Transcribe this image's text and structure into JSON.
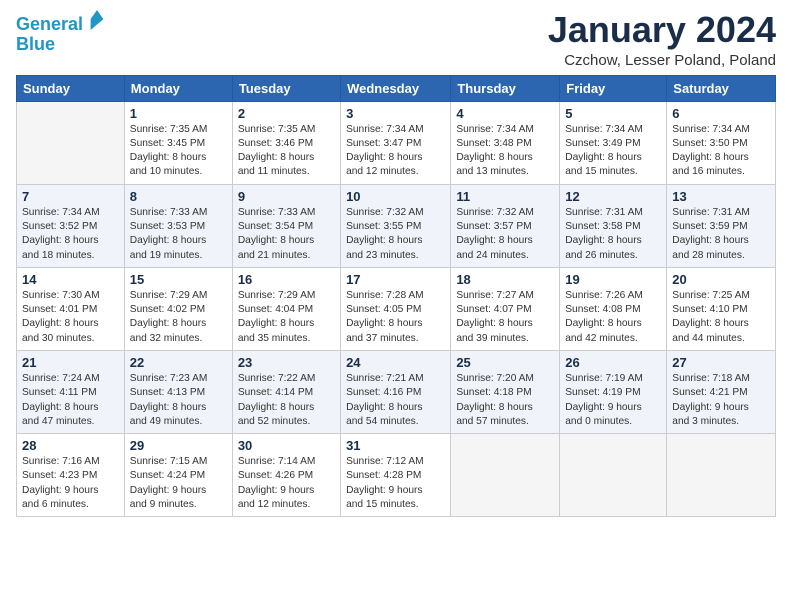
{
  "logo": {
    "line1": "General",
    "line2": "Blue"
  },
  "title": "January 2024",
  "location": "Czchow, Lesser Poland, Poland",
  "weekdays": [
    "Sunday",
    "Monday",
    "Tuesday",
    "Wednesday",
    "Thursday",
    "Friday",
    "Saturday"
  ],
  "weeks": [
    [
      {
        "day": "",
        "info": ""
      },
      {
        "day": "1",
        "info": "Sunrise: 7:35 AM\nSunset: 3:45 PM\nDaylight: 8 hours\nand 10 minutes."
      },
      {
        "day": "2",
        "info": "Sunrise: 7:35 AM\nSunset: 3:46 PM\nDaylight: 8 hours\nand 11 minutes."
      },
      {
        "day": "3",
        "info": "Sunrise: 7:34 AM\nSunset: 3:47 PM\nDaylight: 8 hours\nand 12 minutes."
      },
      {
        "day": "4",
        "info": "Sunrise: 7:34 AM\nSunset: 3:48 PM\nDaylight: 8 hours\nand 13 minutes."
      },
      {
        "day": "5",
        "info": "Sunrise: 7:34 AM\nSunset: 3:49 PM\nDaylight: 8 hours\nand 15 minutes."
      },
      {
        "day": "6",
        "info": "Sunrise: 7:34 AM\nSunset: 3:50 PM\nDaylight: 8 hours\nand 16 minutes."
      }
    ],
    [
      {
        "day": "7",
        "info": "Sunrise: 7:34 AM\nSunset: 3:52 PM\nDaylight: 8 hours\nand 18 minutes."
      },
      {
        "day": "8",
        "info": "Sunrise: 7:33 AM\nSunset: 3:53 PM\nDaylight: 8 hours\nand 19 minutes."
      },
      {
        "day": "9",
        "info": "Sunrise: 7:33 AM\nSunset: 3:54 PM\nDaylight: 8 hours\nand 21 minutes."
      },
      {
        "day": "10",
        "info": "Sunrise: 7:32 AM\nSunset: 3:55 PM\nDaylight: 8 hours\nand 23 minutes."
      },
      {
        "day": "11",
        "info": "Sunrise: 7:32 AM\nSunset: 3:57 PM\nDaylight: 8 hours\nand 24 minutes."
      },
      {
        "day": "12",
        "info": "Sunrise: 7:31 AM\nSunset: 3:58 PM\nDaylight: 8 hours\nand 26 minutes."
      },
      {
        "day": "13",
        "info": "Sunrise: 7:31 AM\nSunset: 3:59 PM\nDaylight: 8 hours\nand 28 minutes."
      }
    ],
    [
      {
        "day": "14",
        "info": "Sunrise: 7:30 AM\nSunset: 4:01 PM\nDaylight: 8 hours\nand 30 minutes."
      },
      {
        "day": "15",
        "info": "Sunrise: 7:29 AM\nSunset: 4:02 PM\nDaylight: 8 hours\nand 32 minutes."
      },
      {
        "day": "16",
        "info": "Sunrise: 7:29 AM\nSunset: 4:04 PM\nDaylight: 8 hours\nand 35 minutes."
      },
      {
        "day": "17",
        "info": "Sunrise: 7:28 AM\nSunset: 4:05 PM\nDaylight: 8 hours\nand 37 minutes."
      },
      {
        "day": "18",
        "info": "Sunrise: 7:27 AM\nSunset: 4:07 PM\nDaylight: 8 hours\nand 39 minutes."
      },
      {
        "day": "19",
        "info": "Sunrise: 7:26 AM\nSunset: 4:08 PM\nDaylight: 8 hours\nand 42 minutes."
      },
      {
        "day": "20",
        "info": "Sunrise: 7:25 AM\nSunset: 4:10 PM\nDaylight: 8 hours\nand 44 minutes."
      }
    ],
    [
      {
        "day": "21",
        "info": "Sunrise: 7:24 AM\nSunset: 4:11 PM\nDaylight: 8 hours\nand 47 minutes."
      },
      {
        "day": "22",
        "info": "Sunrise: 7:23 AM\nSunset: 4:13 PM\nDaylight: 8 hours\nand 49 minutes."
      },
      {
        "day": "23",
        "info": "Sunrise: 7:22 AM\nSunset: 4:14 PM\nDaylight: 8 hours\nand 52 minutes."
      },
      {
        "day": "24",
        "info": "Sunrise: 7:21 AM\nSunset: 4:16 PM\nDaylight: 8 hours\nand 54 minutes."
      },
      {
        "day": "25",
        "info": "Sunrise: 7:20 AM\nSunset: 4:18 PM\nDaylight: 8 hours\nand 57 minutes."
      },
      {
        "day": "26",
        "info": "Sunrise: 7:19 AM\nSunset: 4:19 PM\nDaylight: 9 hours\nand 0 minutes."
      },
      {
        "day": "27",
        "info": "Sunrise: 7:18 AM\nSunset: 4:21 PM\nDaylight: 9 hours\nand 3 minutes."
      }
    ],
    [
      {
        "day": "28",
        "info": "Sunrise: 7:16 AM\nSunset: 4:23 PM\nDaylight: 9 hours\nand 6 minutes."
      },
      {
        "day": "29",
        "info": "Sunrise: 7:15 AM\nSunset: 4:24 PM\nDaylight: 9 hours\nand 9 minutes."
      },
      {
        "day": "30",
        "info": "Sunrise: 7:14 AM\nSunset: 4:26 PM\nDaylight: 9 hours\nand 12 minutes."
      },
      {
        "day": "31",
        "info": "Sunrise: 7:12 AM\nSunset: 4:28 PM\nDaylight: 9 hours\nand 15 minutes."
      },
      {
        "day": "",
        "info": ""
      },
      {
        "day": "",
        "info": ""
      },
      {
        "day": "",
        "info": ""
      }
    ]
  ]
}
